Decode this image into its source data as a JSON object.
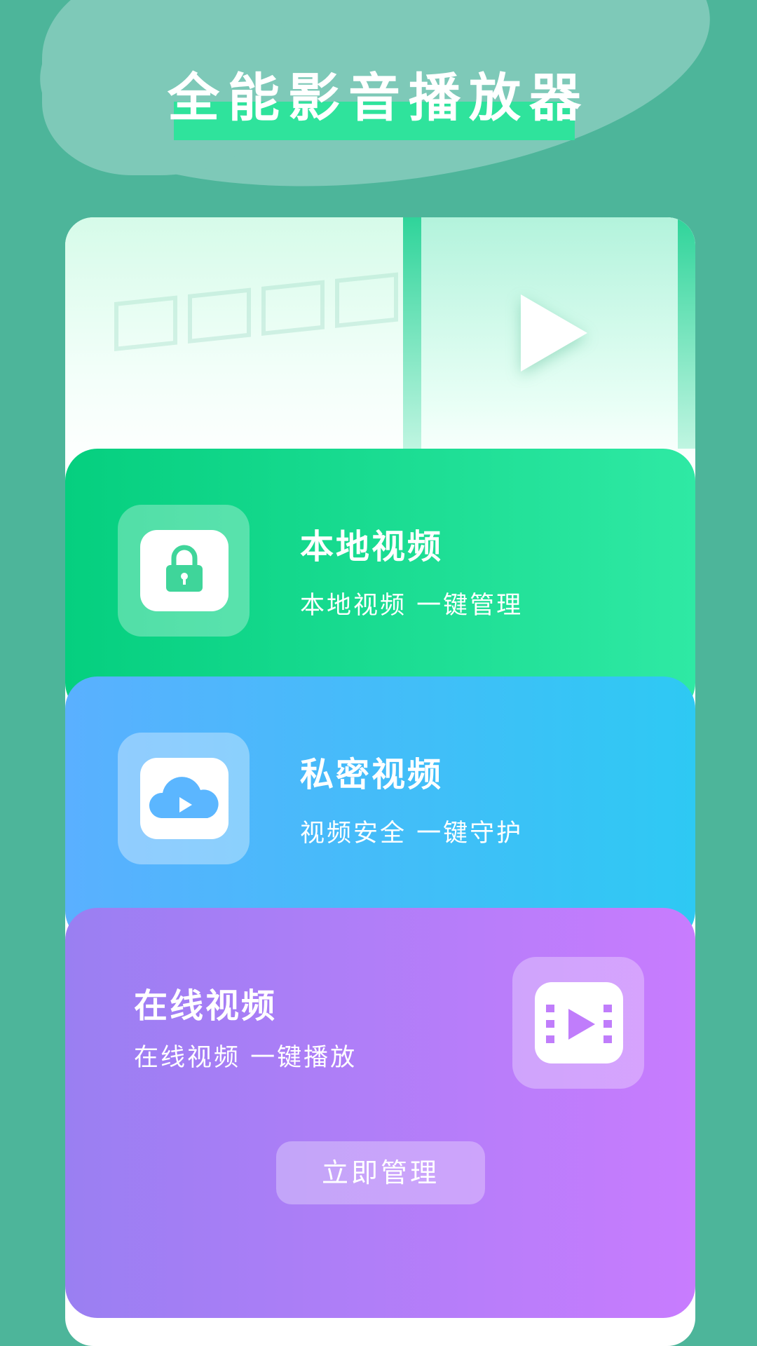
{
  "app": {
    "title": "全能影音播放器"
  },
  "sections": [
    {
      "title": "本地视频",
      "subtitle": "本地视频 一键管理",
      "icon": "lock-icon"
    },
    {
      "title": "私密视频",
      "subtitle": "视频安全 一键守护",
      "icon": "cloud-play-icon"
    },
    {
      "title": "在线视频",
      "subtitle": "在线视频 一键播放",
      "icon": "film-play-icon"
    }
  ],
  "action": {
    "label": "立即管理"
  },
  "colors": {
    "background": "#4db59a",
    "title_highlight": "#2fe39c",
    "green_section": "#05cf7f",
    "blue_section": "#2ec9f3",
    "purple_section": "#c87cfe"
  }
}
